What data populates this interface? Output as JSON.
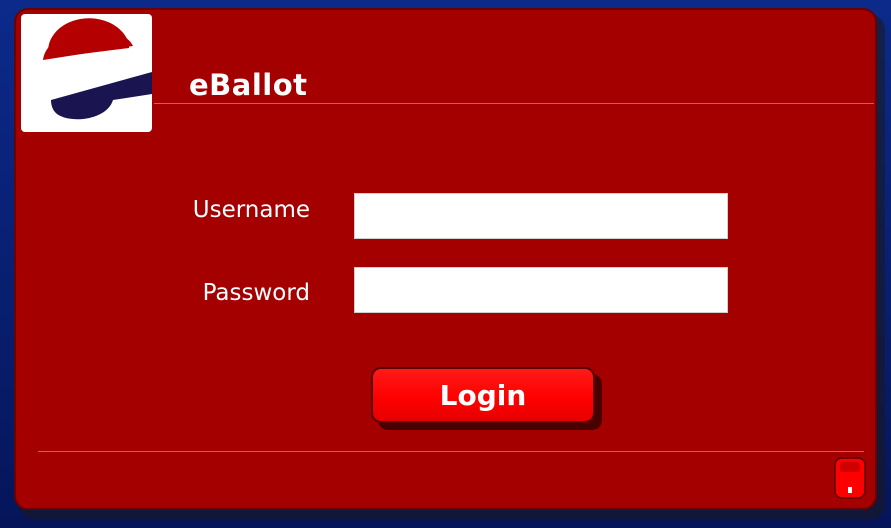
{
  "app": {
    "title": "eBallot",
    "logo_icon": "eballot-e-logo-icon"
  },
  "form": {
    "username_label": "Username",
    "password_label": "Password",
    "username_value": "",
    "password_value": "",
    "login_label": "Login"
  },
  "footer": {
    "lock_icon": "lock-icon"
  },
  "colors": {
    "panel": "#a40000",
    "button": "#ff0000",
    "background": "#0a1f73",
    "logo_red": "#b40000",
    "logo_navy": "#1a1450"
  }
}
